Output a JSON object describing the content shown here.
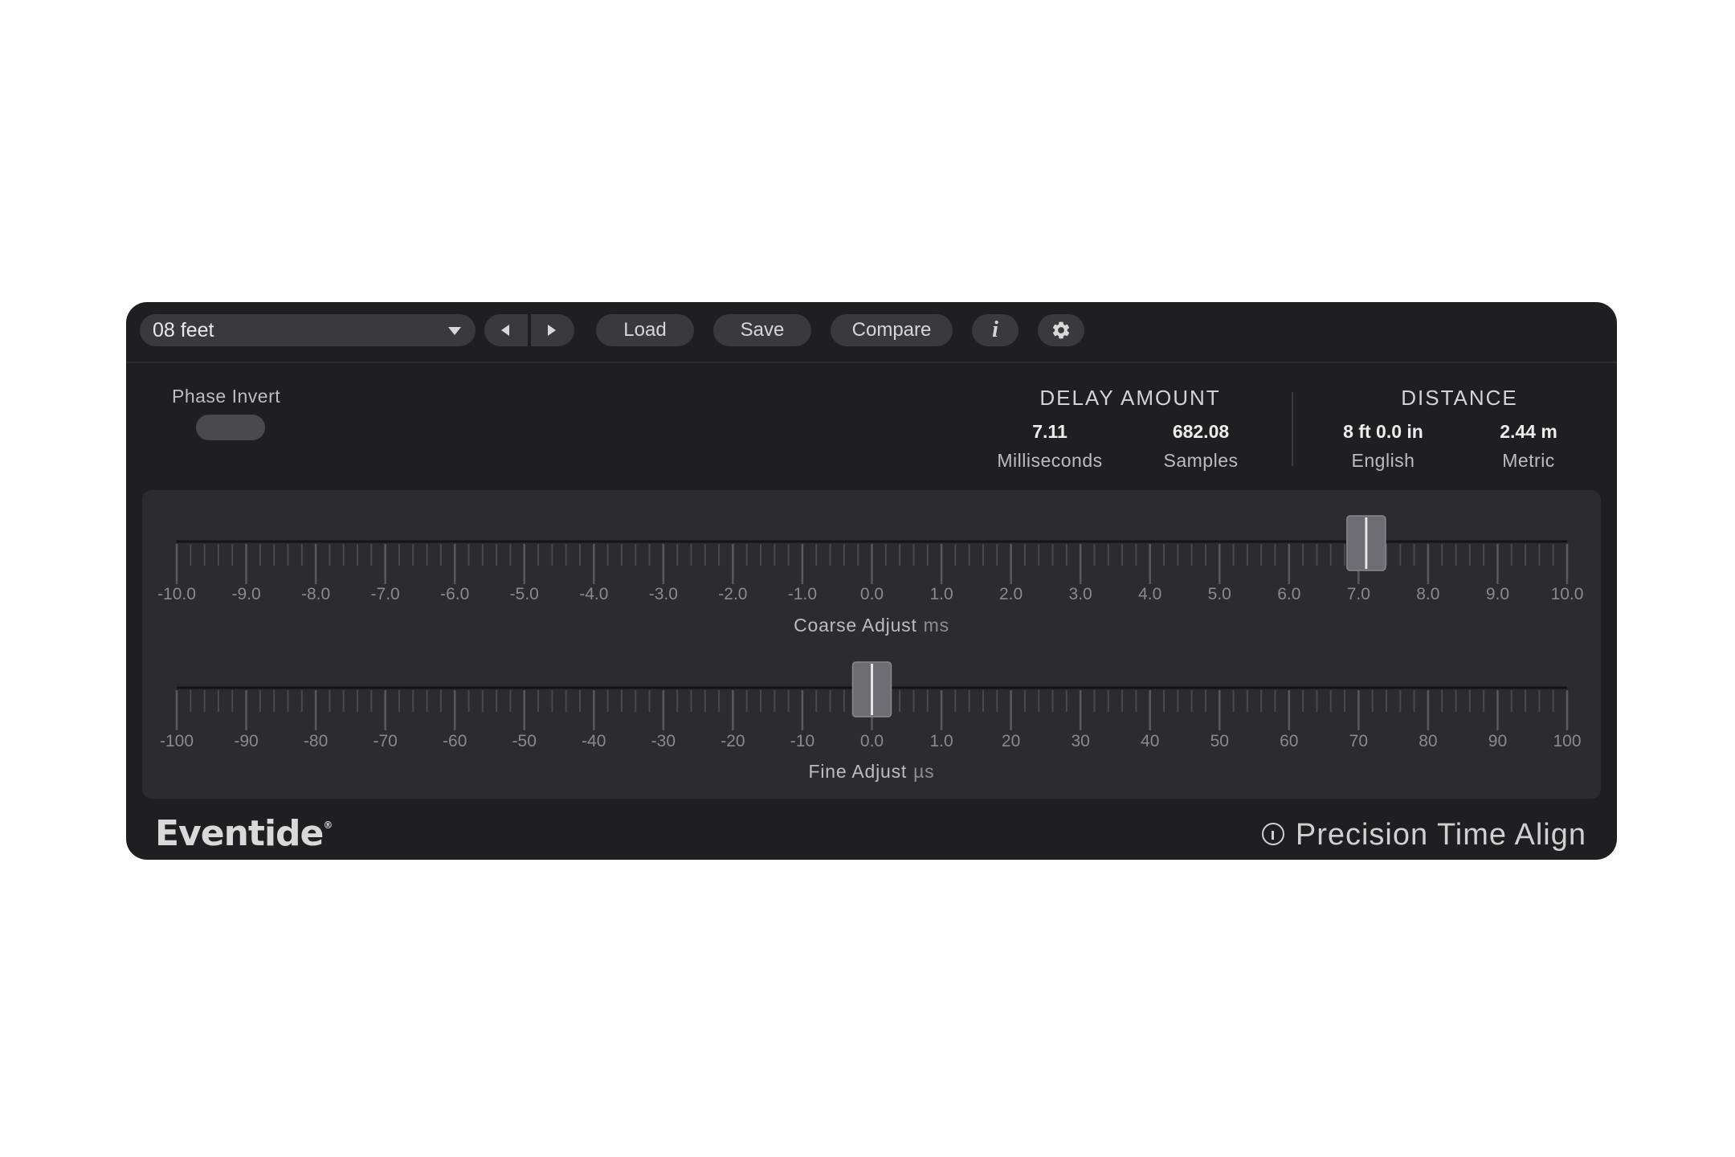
{
  "toolbar": {
    "preset": "08 feet",
    "load": "Load",
    "save": "Save",
    "compare": "Compare",
    "info": "i"
  },
  "phase_invert": {
    "label": "Phase Invert",
    "on": false
  },
  "delay_amount": {
    "title": "DELAY AMOUNT",
    "ms_value": "7.11",
    "ms_unit": "Milliseconds",
    "samples_value": "682.08",
    "samples_unit": "Samples"
  },
  "distance": {
    "title": "DISTANCE",
    "english_value": "8 ft 0.0 in",
    "english_unit": "English",
    "metric_value": "2.44 m",
    "metric_unit": "Metric"
  },
  "coarse": {
    "label": "Coarse Adjust",
    "unit": "ms",
    "min": -10,
    "max": 10,
    "value": 7.11,
    "ticks": [
      "-10.0",
      "-9.0",
      "-8.0",
      "-7.0",
      "-6.0",
      "-5.0",
      "-4.0",
      "-3.0",
      "-2.0",
      "-1.0",
      "0.0",
      "1.0",
      "2.0",
      "3.0",
      "4.0",
      "5.0",
      "6.0",
      "7.0",
      "8.0",
      "9.0",
      "10.0"
    ]
  },
  "fine": {
    "label": "Fine Adjust",
    "unit": "µs",
    "min": -100,
    "max": 100,
    "value": 0,
    "ticks": [
      "-100",
      "-90",
      "-80",
      "-70",
      "-60",
      "-50",
      "-40",
      "-30",
      "-20",
      "-10",
      "0.0",
      "1.0",
      "20",
      "30",
      "40",
      "50",
      "60",
      "70",
      "80",
      "90",
      "100"
    ]
  },
  "footer": {
    "brand": "Eventide",
    "registered": "®",
    "product": "Precision Time Align"
  },
  "colors": {
    "panel": "#1f1f21",
    "slider_bg": "#2c2c2f",
    "text": "#d4d4d4"
  }
}
